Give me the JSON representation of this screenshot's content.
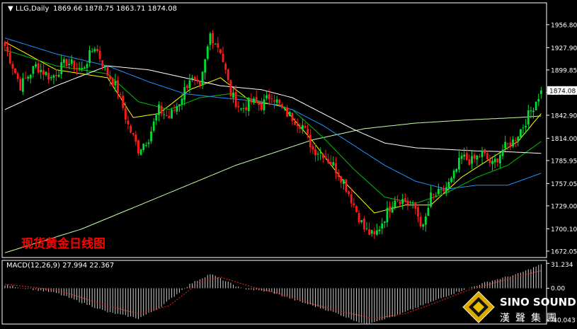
{
  "header": {
    "symbol": "LLG,Daily",
    "ohlc": "1869.66 1878.75 1863.71 1874.08"
  },
  "chart_title": "现货黄金日线图",
  "colors": {
    "bg": "#000000",
    "frame": "#ffffff",
    "bull": "#00dd33",
    "bear": "#ff1a1a",
    "ma_yellow": "#ffff00",
    "ma_green": "#00c000",
    "ma_blue": "#1e90ff",
    "ma_white": "#ffffff",
    "ma_long": "#c8ffa0",
    "macd_hist": "#cccccc",
    "macd_signal": "#ff2020",
    "title": "#ff0000"
  },
  "chart_data": [
    {
      "type": "candlestick",
      "title": "现货黄金日线图",
      "legend": "LLG,Daily",
      "ylim": [
        1664,
        1970
      ],
      "y_ticks": [
        "1956.80",
        "1927.90",
        "1899.85",
        "1871.80",
        "1842.90",
        "1814.00",
        "1785.95",
        "1757.05",
        "1729.00",
        "1700.10",
        "1672.05"
      ],
      "last_price": "1874.08",
      "last_ohlc": {
        "open": 1869.66,
        "high": 1878.75,
        "low": 1863.71,
        "close": 1874.08
      },
      "close_path": [
        [
          0,
          1930
        ],
        [
          6,
          1880
        ],
        [
          12,
          1905
        ],
        [
          18,
          1890
        ],
        [
          24,
          1910
        ],
        [
          30,
          1900
        ],
        [
          35,
          1930
        ],
        [
          40,
          1895
        ],
        [
          44,
          1875
        ],
        [
          48,
          1830
        ],
        [
          52,
          1800
        ],
        [
          56,
          1815
        ],
        [
          60,
          1850
        ],
        [
          64,
          1840
        ],
        [
          68,
          1860
        ],
        [
          72,
          1890
        ],
        [
          76,
          1875
        ],
        [
          80,
          1945
        ],
        [
          84,
          1925
        ],
        [
          88,
          1870
        ],
        [
          92,
          1850
        ],
        [
          96,
          1860
        ],
        [
          100,
          1855
        ],
        [
          104,
          1870
        ],
        [
          108,
          1850
        ],
        [
          112,
          1840
        ],
        [
          116,
          1830
        ],
        [
          120,
          1800
        ],
        [
          124,
          1795
        ],
        [
          128,
          1780
        ],
        [
          132,
          1760
        ],
        [
          136,
          1730
        ],
        [
          140,
          1700
        ],
        [
          144,
          1690
        ],
        [
          148,
          1715
        ],
        [
          152,
          1740
        ],
        [
          156,
          1735
        ],
        [
          160,
          1725
        ],
        [
          163,
          1700
        ],
        [
          166,
          1740
        ],
        [
          170,
          1745
        ],
        [
          174,
          1760
        ],
        [
          178,
          1790
        ],
        [
          182,
          1785
        ],
        [
          186,
          1795
        ],
        [
          190,
          1780
        ],
        [
          194,
          1800
        ],
        [
          198,
          1810
        ],
        [
          202,
          1830
        ],
        [
          206,
          1855
        ],
        [
          209,
          1874
        ]
      ],
      "moving_averages": [
        {
          "name": "",
          "color": "#ffff00",
          "points": [
            [
              0,
              1935
            ],
            [
              20,
              1900
            ],
            [
              40,
              1890
            ],
            [
              50,
              1840
            ],
            [
              60,
              1845
            ],
            [
              72,
              1875
            ],
            [
              84,
              1890
            ],
            [
              96,
              1860
            ],
            [
              108,
              1855
            ],
            [
              120,
              1810
            ],
            [
              132,
              1760
            ],
            [
              144,
              1720
            ],
            [
              156,
              1730
            ],
            [
              166,
              1730
            ],
            [
              178,
              1765
            ],
            [
              190,
              1790
            ],
            [
              200,
              1810
            ],
            [
              209,
              1845
            ]
          ]
        },
        {
          "name": "",
          "color": "#00c000",
          "points": [
            [
              0,
              1925
            ],
            [
              20,
              1905
            ],
            [
              40,
              1895
            ],
            [
              52,
              1860
            ],
            [
              64,
              1850
            ],
            [
              76,
              1865
            ],
            [
              88,
              1870
            ],
            [
              100,
              1860
            ],
            [
              112,
              1850
            ],
            [
              124,
              1815
            ],
            [
              136,
              1775
            ],
            [
              148,
              1740
            ],
            [
              160,
              1732
            ],
            [
              172,
              1745
            ],
            [
              184,
              1765
            ],
            [
              196,
              1780
            ],
            [
              209,
              1810
            ]
          ]
        },
        {
          "name": "",
          "color": "#1e90ff",
          "points": [
            [
              0,
              1940
            ],
            [
              20,
              1920
            ],
            [
              40,
              1905
            ],
            [
              56,
              1885
            ],
            [
              70,
              1870
            ],
            [
              84,
              1865
            ],
            [
              100,
              1860
            ],
            [
              112,
              1850
            ],
            [
              124,
              1830
            ],
            [
              136,
              1805
            ],
            [
              148,
              1780
            ],
            [
              160,
              1760
            ],
            [
              172,
              1750
            ],
            [
              184,
              1755
            ],
            [
              196,
              1755
            ],
            [
              209,
              1770
            ]
          ]
        },
        {
          "name": "",
          "color": "#ffffff",
          "points": [
            [
              0,
              1850
            ],
            [
              20,
              1880
            ],
            [
              40,
              1905
            ],
            [
              56,
              1900
            ],
            [
              70,
              1890
            ],
            [
              84,
              1880
            ],
            [
              100,
              1875
            ],
            [
              112,
              1865
            ],
            [
              124,
              1845
            ],
            [
              136,
              1825
            ],
            [
              148,
              1808
            ],
            [
              160,
              1802
            ],
            [
              172,
              1800
            ],
            [
              184,
              1798
            ],
            [
              196,
              1797
            ],
            [
              209,
              1795
            ]
          ]
        },
        {
          "name": "",
          "color": "#c8ffa0",
          "points": [
            [
              0,
              1670
            ],
            [
              30,
              1700
            ],
            [
              60,
              1740
            ],
            [
              90,
              1780
            ],
            [
              120,
              1812
            ],
            [
              140,
              1826
            ],
            [
              160,
              1833
            ],
            [
              180,
              1837
            ],
            [
              200,
              1840
            ],
            [
              209,
              1842
            ]
          ]
        }
      ]
    },
    {
      "type": "bar",
      "title": "",
      "legend": "MACD(12,26,9) 27.994 22.367",
      "ylim": [
        -45,
        35
      ],
      "y_ticks": [
        "31.234",
        "0.00",
        "-40.043"
      ],
      "macd_path": [
        [
          0,
          4
        ],
        [
          20,
          -6
        ],
        [
          40,
          -30
        ],
        [
          52,
          -38
        ],
        [
          60,
          -25
        ],
        [
          72,
          5
        ],
        [
          80,
          18
        ],
        [
          92,
          0
        ],
        [
          104,
          -5
        ],
        [
          116,
          -18
        ],
        [
          128,
          -30
        ],
        [
          140,
          -45
        ],
        [
          152,
          -35
        ],
        [
          164,
          -20
        ],
        [
          176,
          -5
        ],
        [
          188,
          8
        ],
        [
          200,
          18
        ],
        [
          209,
          30
        ]
      ],
      "signal_path": [
        [
          0,
          5
        ],
        [
          20,
          -2
        ],
        [
          40,
          -22
        ],
        [
          52,
          -32
        ],
        [
          64,
          -22
        ],
        [
          76,
          8
        ],
        [
          84,
          14
        ],
        [
          96,
          2
        ],
        [
          108,
          -8
        ],
        [
          120,
          -20
        ],
        [
          132,
          -30
        ],
        [
          144,
          -38
        ],
        [
          156,
          -32
        ],
        [
          168,
          -18
        ],
        [
          180,
          -3
        ],
        [
          192,
          8
        ],
        [
          204,
          18
        ],
        [
          209,
          22
        ]
      ]
    }
  ],
  "brand": {
    "name": "SINO SOUND",
    "chinese": "漢聲集團"
  }
}
